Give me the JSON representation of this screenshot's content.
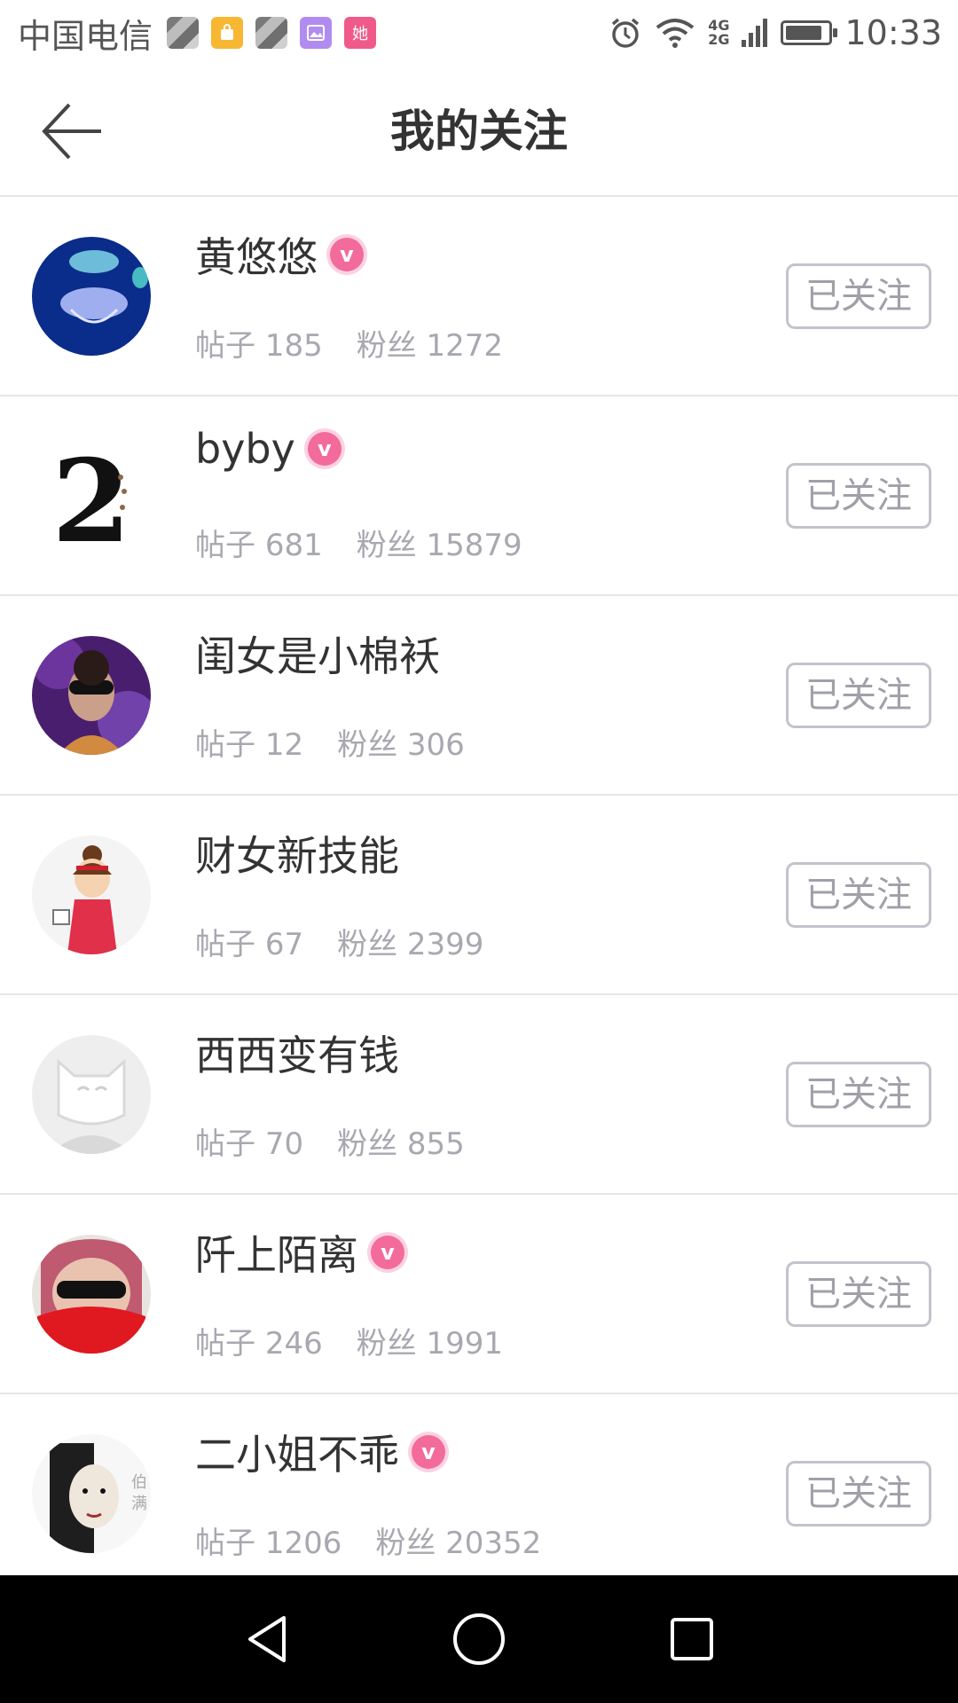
{
  "status_bar": {
    "carrier": "中国电信",
    "network_top": "4G",
    "network_bottom": "2G",
    "time": "10:33",
    "battery_level": 0.85,
    "notification_icons": [
      "photo-grid-icon",
      "shopping-bag-icon",
      "photo-grid-icon",
      "gallery-icon",
      "she-app-icon"
    ],
    "she_app_text": "她"
  },
  "header": {
    "title": "我的关注"
  },
  "labels": {
    "posts": "帖子",
    "fans": "粉丝"
  },
  "follow_label": "已关注",
  "accent_color": "#f26b9a",
  "users": [
    {
      "name": "黄悠悠",
      "verified": true,
      "posts": "185",
      "fans": "1272",
      "avatar": "jellyfish"
    },
    {
      "name": "byby",
      "verified": true,
      "posts": "681",
      "fans": "15879",
      "avatar": "number-two"
    },
    {
      "name": "闺女是小棉袄",
      "verified": false,
      "posts": "12",
      "fans": "306",
      "avatar": "masked-woman"
    },
    {
      "name": "财女新技能",
      "verified": false,
      "posts": "67",
      "fans": "2399",
      "avatar": "cartoon-girl"
    },
    {
      "name": "西西变有钱",
      "verified": false,
      "posts": "70",
      "fans": "855",
      "avatar": "default-cat"
    },
    {
      "name": "阡上陌离",
      "verified": true,
      "posts": "246",
      "fans": "1991",
      "avatar": "sunglasses-scarf"
    },
    {
      "name": "二小姐不乖",
      "verified": true,
      "posts": "1206",
      "fans": "20352",
      "avatar": "ink-portrait"
    }
  ],
  "nav": {
    "back": "back-triangle-icon",
    "home": "home-circle-icon",
    "recents": "recents-square-icon"
  }
}
